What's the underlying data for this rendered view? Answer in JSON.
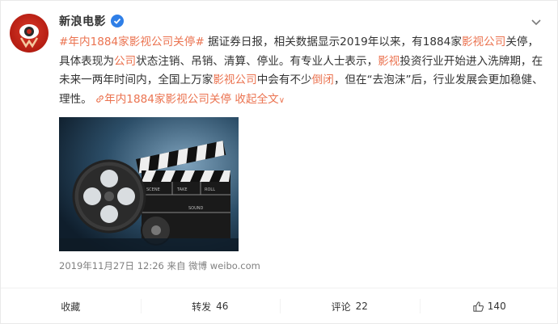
{
  "author": {
    "name": "新浪电影",
    "verified": true
  },
  "post": {
    "hashtag": "#年内1884家影视公司关停#",
    "text1": "据证券日报，相关数据显示2019年以来，有1884家",
    "hl1": "影视公司",
    "text2": "关停，具体表现为",
    "hl2": "公司",
    "text3": "状态注销、吊销、清算、停业。有专业人士表示，",
    "hl3": "影视",
    "text4": "投资行业开始进入洗牌期，在未来一两年时间内，全国上万家",
    "hl4": "影视公司",
    "text5": "中会有不少",
    "hl5": "倒闭",
    "text6": "，但在“去泡沫”后，行业发展会更加稳健、理性。",
    "link_text_a": "年内1884家",
    "link_text_b": "影视公司",
    "link_text_c": "关停",
    "expand": "收起全文",
    "expand_arrow": "∨"
  },
  "meta": {
    "time": "2019年11月27日 12:26",
    "from": "来自 微博 weibo.com"
  },
  "clapper_text": {
    "scene": "SCENE",
    "take": "TAKE",
    "roll": "ROLL",
    "sound": "SOUND"
  },
  "actions": {
    "favorite": "收藏",
    "repost_label": "转发",
    "repost_count": "46",
    "comment_label": "评论",
    "comment_count": "22",
    "like_count": "140"
  },
  "colors": {
    "highlight": "#eb7350",
    "verified": "#2f7fe7",
    "avatar_red": "#c4261a"
  },
  "icons": [
    "avatar-logo",
    "verified-icon",
    "chevron-down-icon",
    "link-icon",
    "like-icon"
  ]
}
